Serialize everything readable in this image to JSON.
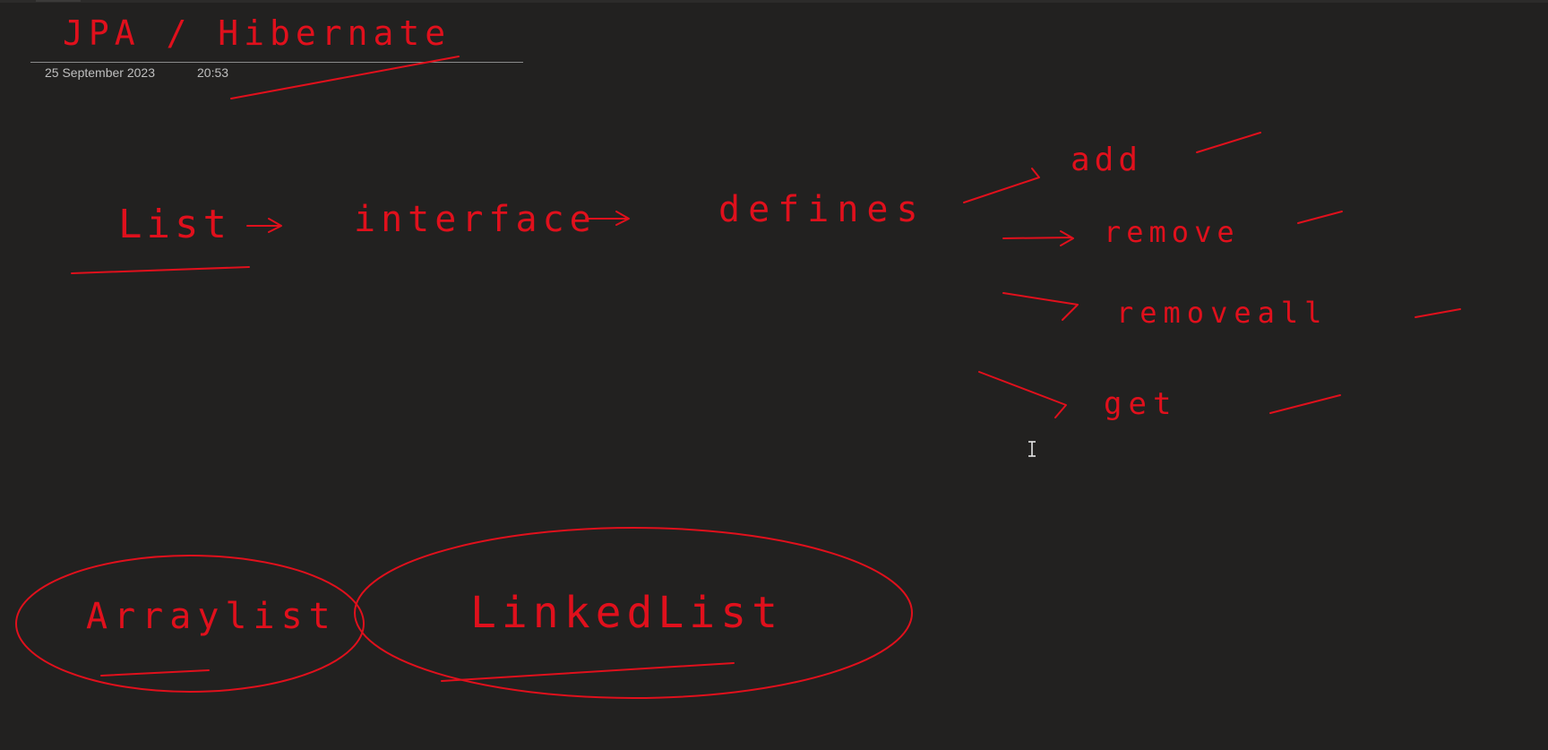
{
  "page": {
    "title_ink": "JPA / Hibernate",
    "date": "25 September 2023",
    "time": "20:53"
  },
  "ink": {
    "list_word": "List",
    "interface_word": "interface",
    "defines_word": "defines",
    "methods": [
      "add",
      "remove",
      "removeall",
      "get"
    ],
    "arraylist_word": "Arraylist",
    "linkedlist_word": "LinkedList"
  },
  "colors": {
    "background": "#222120",
    "ink": "#e0101c",
    "meta_text": "#bfbfbf"
  }
}
